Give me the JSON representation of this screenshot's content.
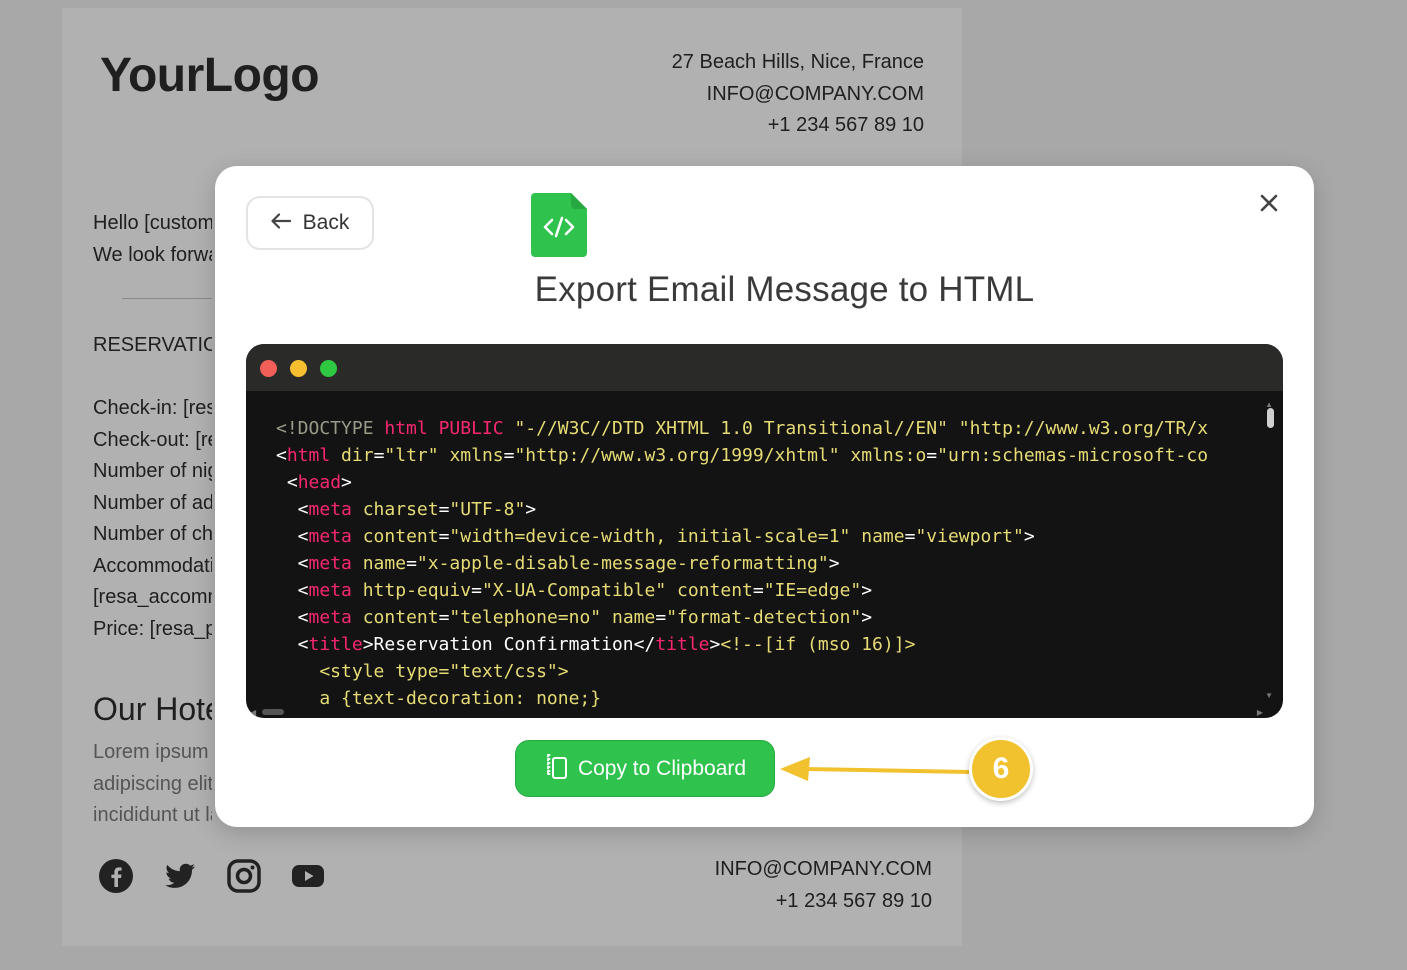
{
  "email": {
    "logo": "YourLogo",
    "address": "27 Beach Hills, Nice, France",
    "email": "INFO@COMPANY.COM",
    "phone": "+1 234 567 89 10",
    "greeting_lines": [
      "Hello [customer_name],",
      "We look forward to welcoming you"
    ],
    "reservation_title": "RESERVATION DETAILS",
    "reservation_lines": [
      "Check-in: [resa_check_in]",
      "Check-out: [resa_check_out]",
      "Number of nights: [resa_nights]",
      "Number of adults: [resa_adults]",
      "Number of children: [resa_children]",
      "Accommodation:",
      "[resa_accommodation]",
      "Price: [resa_price]"
    ],
    "hotel_title": "Our Hotel",
    "hotel_text_lines": [
      "Lorem ipsum dolor sit amet, consectetur",
      "adipiscing elit, sed do eiusmod tempor",
      "incididunt ut labore et dolore magna"
    ],
    "footer_email": "INFO@COMPANY.COM",
    "footer_phone": "+1 234 567 89 10",
    "social_icons": [
      "facebook-icon",
      "twitter-icon",
      "instagram-icon",
      "youtube-icon"
    ]
  },
  "modal": {
    "back_label": "Back",
    "title": "Export Email Message to HTML",
    "copy_label": "Copy to Clipboard",
    "step_number": "6",
    "colors": {
      "accent_green": "#2fc24d",
      "code_bg": "#131313",
      "tag_pink": "#f92672",
      "string_yellow": "#e6db74",
      "comment_gray": "#9a9a8a",
      "step_badge": "#f2c12e"
    },
    "code_lines": [
      [
        [
          "c",
          "<!DOCTYPE "
        ],
        [
          "t",
          "html"
        ],
        [
          "w",
          " "
        ],
        [
          "t",
          "PUBLIC"
        ],
        [
          "w",
          " "
        ],
        [
          "s",
          "\"-//W3C//DTD XHTML 1.0 Transitional//EN\""
        ],
        [
          "w",
          " "
        ],
        [
          "s",
          "\"http://www.w3.org/TR/x"
        ]
      ],
      [
        [
          "w",
          "<"
        ],
        [
          "t",
          "html"
        ],
        [
          "w",
          " "
        ],
        [
          "a",
          "dir"
        ],
        [
          "w",
          "="
        ],
        [
          "s",
          "\"ltr\""
        ],
        [
          "w",
          " "
        ],
        [
          "a",
          "xmlns"
        ],
        [
          "w",
          "="
        ],
        [
          "s",
          "\"http://www.w3.org/1999/xhtml\""
        ],
        [
          "w",
          " "
        ],
        [
          "a",
          "xmlns:o"
        ],
        [
          "w",
          "="
        ],
        [
          "s",
          "\"urn:schemas-microsoft-co"
        ]
      ],
      [
        [
          "w",
          " <"
        ],
        [
          "t",
          "head"
        ],
        [
          "w",
          ">"
        ]
      ],
      [
        [
          "w",
          "  <"
        ],
        [
          "t",
          "meta"
        ],
        [
          "w",
          " "
        ],
        [
          "a",
          "charset"
        ],
        [
          "w",
          "="
        ],
        [
          "s",
          "\"UTF-8\""
        ],
        [
          "w",
          ">"
        ]
      ],
      [
        [
          "w",
          "  <"
        ],
        [
          "t",
          "meta"
        ],
        [
          "w",
          " "
        ],
        [
          "a",
          "content"
        ],
        [
          "w",
          "="
        ],
        [
          "s",
          "\"width=device-width, initial-scale=1\""
        ],
        [
          "w",
          " "
        ],
        [
          "a",
          "name"
        ],
        [
          "w",
          "="
        ],
        [
          "s",
          "\"viewport\""
        ],
        [
          "w",
          ">"
        ]
      ],
      [
        [
          "w",
          "  <"
        ],
        [
          "t",
          "meta"
        ],
        [
          "w",
          " "
        ],
        [
          "a",
          "name"
        ],
        [
          "w",
          "="
        ],
        [
          "s",
          "\"x-apple-disable-message-reformatting\""
        ],
        [
          "w",
          ">"
        ]
      ],
      [
        [
          "w",
          "  <"
        ],
        [
          "t",
          "meta"
        ],
        [
          "w",
          " "
        ],
        [
          "a",
          "http-equiv"
        ],
        [
          "w",
          "="
        ],
        [
          "s",
          "\"X-UA-Compatible\""
        ],
        [
          "w",
          " "
        ],
        [
          "a",
          "content"
        ],
        [
          "w",
          "="
        ],
        [
          "s",
          "\"IE=edge\""
        ],
        [
          "w",
          ">"
        ]
      ],
      [
        [
          "w",
          "  <"
        ],
        [
          "t",
          "meta"
        ],
        [
          "w",
          " "
        ],
        [
          "a",
          "content"
        ],
        [
          "w",
          "="
        ],
        [
          "s",
          "\"telephone=no\""
        ],
        [
          "w",
          " "
        ],
        [
          "a",
          "name"
        ],
        [
          "w",
          "="
        ],
        [
          "s",
          "\"format-detection\""
        ],
        [
          "w",
          ">"
        ]
      ],
      [
        [
          "w",
          "  <"
        ],
        [
          "t",
          "title"
        ],
        [
          "w",
          ">Reservation Confirmation</"
        ],
        [
          "t",
          "title"
        ],
        [
          "w",
          ">"
        ],
        [
          "s",
          "<!--[if (mso 16)]>"
        ]
      ],
      [
        [
          "s",
          "    <style type=\"text/css\">"
        ]
      ],
      [
        [
          "s",
          "    a {text-decoration: none;}"
        ]
      ]
    ]
  }
}
